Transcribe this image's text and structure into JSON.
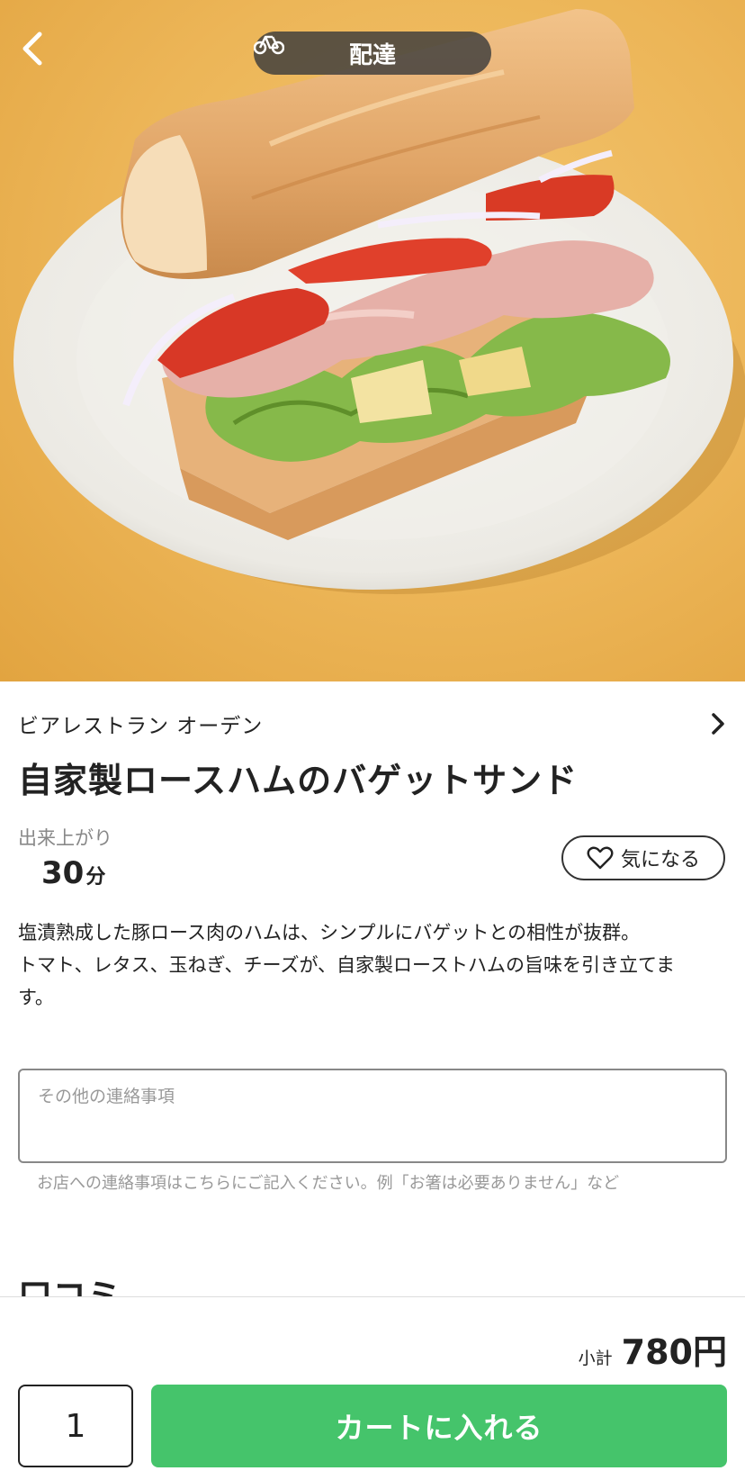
{
  "header": {
    "delivery_label": "配達",
    "icons": {
      "back": "chevron-left-icon",
      "delivery": "bicycle-icon"
    }
  },
  "item": {
    "shop_name": "ビアレストラン オーデン",
    "title": "自家製ロースハムのバゲットサンド",
    "prep_label": "出来上がり",
    "prep_value": "30",
    "prep_unit": "分",
    "favorite_label": "気になる",
    "description_lines": [
      "塩漬熟成した豚ロース肉のハムは、シンプルにバゲットとの相性が抜群。",
      "トマト、レタス、玉ねぎ、チーズが、自家製ローストハムの旨味を引き立てま",
      "す。"
    ]
  },
  "notes": {
    "placeholder": "その他の連絡事項",
    "value": "",
    "hint": "お店への連絡事項はこちらにご記入ください。例「お箸は必要ありません」など"
  },
  "reviews": {
    "heading": "口コミ"
  },
  "footer": {
    "subtotal_label": "小計",
    "subtotal_value": "780円",
    "quantity": "1",
    "cart_button": "カートに入れる"
  },
  "colors": {
    "accent": "#45c46b",
    "hero_bg": "#ecb557",
    "pill_bg": "#3c3c3c"
  }
}
